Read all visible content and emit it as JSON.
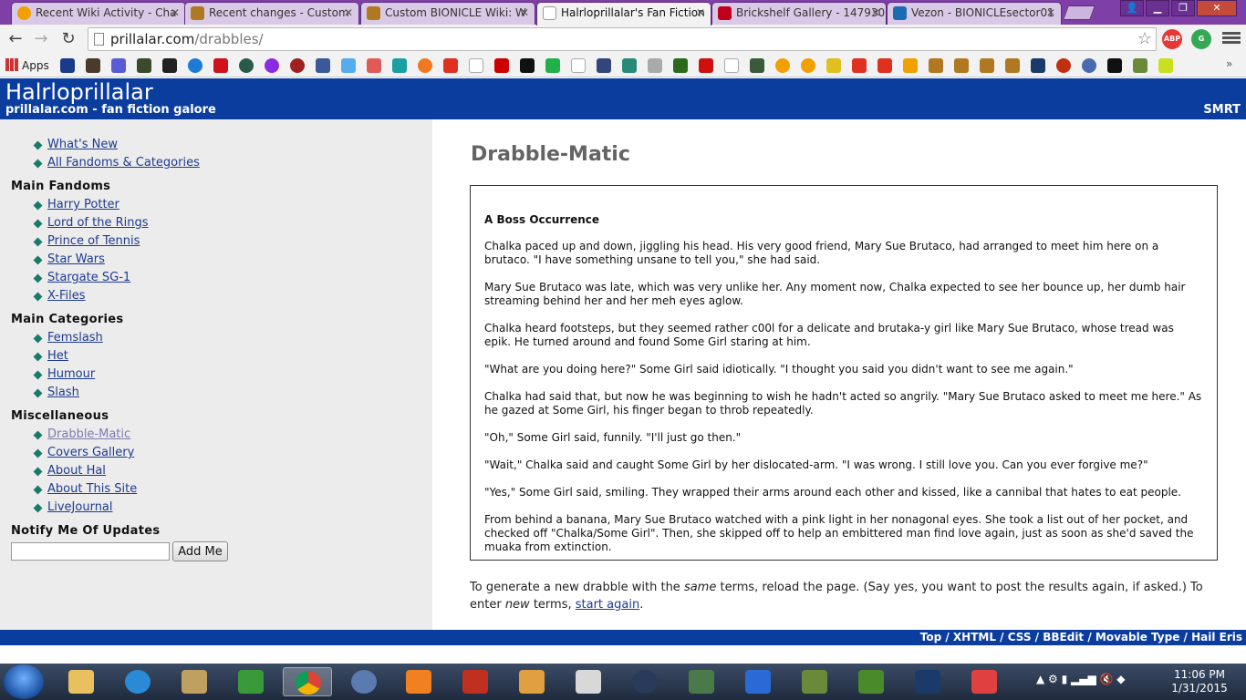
{
  "browser": {
    "tabs": [
      {
        "title": "Recent Wiki Activity - Cha",
        "active": false,
        "color": "#f0a000"
      },
      {
        "title": "Recent changes - Custom",
        "active": false,
        "color": "#b07820"
      },
      {
        "title": "Custom BIONICLE Wiki: W",
        "active": false,
        "color": "#b07820"
      },
      {
        "title": "Halrloprillalar's Fan Fiction",
        "active": true,
        "color": "#ffffff"
      },
      {
        "title": "Brickshelf Gallery - 147930",
        "active": false,
        "color": "#c0001a"
      },
      {
        "title": "Vezon - BIONICLEsector01",
        "active": false,
        "color": "#1a6bb0"
      }
    ],
    "url_host": "prillalar.com",
    "url_path": "/drabbles/",
    "bookmarks_apps_label": "Apps"
  },
  "site": {
    "title": "Halrloprillalar",
    "tagline": "prillalar.com - fan fiction galore",
    "header_right": "SMRT"
  },
  "sidebar": {
    "top_links": [
      "What's New",
      "All Fandoms & Categories"
    ],
    "fandoms_heading": "Main Fandoms",
    "fandoms": [
      "Harry Potter",
      "Lord of the Rings",
      "Prince of Tennis",
      "Star Wars",
      "Stargate SG-1",
      "X-Files"
    ],
    "categories_heading": "Main Categories",
    "categories": [
      "Femslash",
      "Het",
      "Humour",
      "Slash"
    ],
    "misc_heading": "Miscellaneous",
    "misc": [
      "Drabble-Matic",
      "Covers Gallery",
      "About Hal",
      "About This Site",
      "LiveJournal"
    ],
    "notify_heading": "Notify Me Of Updates",
    "notify_value": "",
    "notify_button": "Add Me"
  },
  "main": {
    "page_title": "Drabble-Matic",
    "story_title": "A Boss Occurrence",
    "paragraphs": [
      "Chalka paced up and down, jiggling his head. His very good friend, Mary Sue Brutaco, had arranged to meet him here on a brutaco. \"I have something unsane to tell you,\" she had said.",
      "Mary Sue Brutaco was late, which was very unlike her. Any moment now, Chalka expected to see her bounce up, her dumb hair streaming behind her and her meh eyes aglow.",
      "Chalka heard footsteps, but they seemed rather c00l for a delicate and brutaka-y girl like Mary Sue Brutaco, whose tread was epik. He turned around and found Some Girl staring at him.",
      "\"What are you doing here?\" Some Girl said idiotically. \"I thought you said you didn't want to see me again.\"",
      "Chalka had said that, but now he was beginning to wish he hadn't acted so angrily. \"Mary Sue Brutaco asked to meet me here.\" As he gazed at Some Girl, his finger began to throb repeatedly.",
      "\"Oh,\" Some Girl said, funnily. \"I'll just go then.\"",
      "\"Wait,\" Chalka said and caught Some Girl by her dislocated-arm. \"I was wrong. I still love you. Can you ever forgive me?\"",
      "\"Yes,\" Some Girl said, smiling. They wrapped their arms around each other and kissed, like a cannibal that hates to eat people.",
      "From behind a banana, Mary Sue Brutaco watched with a pink light in her nonagonal eyes. She took a list out of her pocket, and checked off \"Chalka/Some Girl\". Then, she skipped off to help an embittered man find love again, just as soon as she'd saved the muaka from extinction."
    ],
    "foot_before": "To generate a new drabble with the ",
    "foot_em1": "same",
    "foot_mid": " terms, reload the page. (Say yes, you want to post the results again, if asked.) To enter ",
    "foot_em2": "new",
    "foot_mid2": " terms, ",
    "foot_link": "start again",
    "foot_end": "."
  },
  "footer": {
    "links": "Top / XHTML / CSS / BBEdit / Movable Type / Hail Eris"
  },
  "taskbar": {
    "time": "11:06 PM",
    "date": "1/31/2015"
  }
}
